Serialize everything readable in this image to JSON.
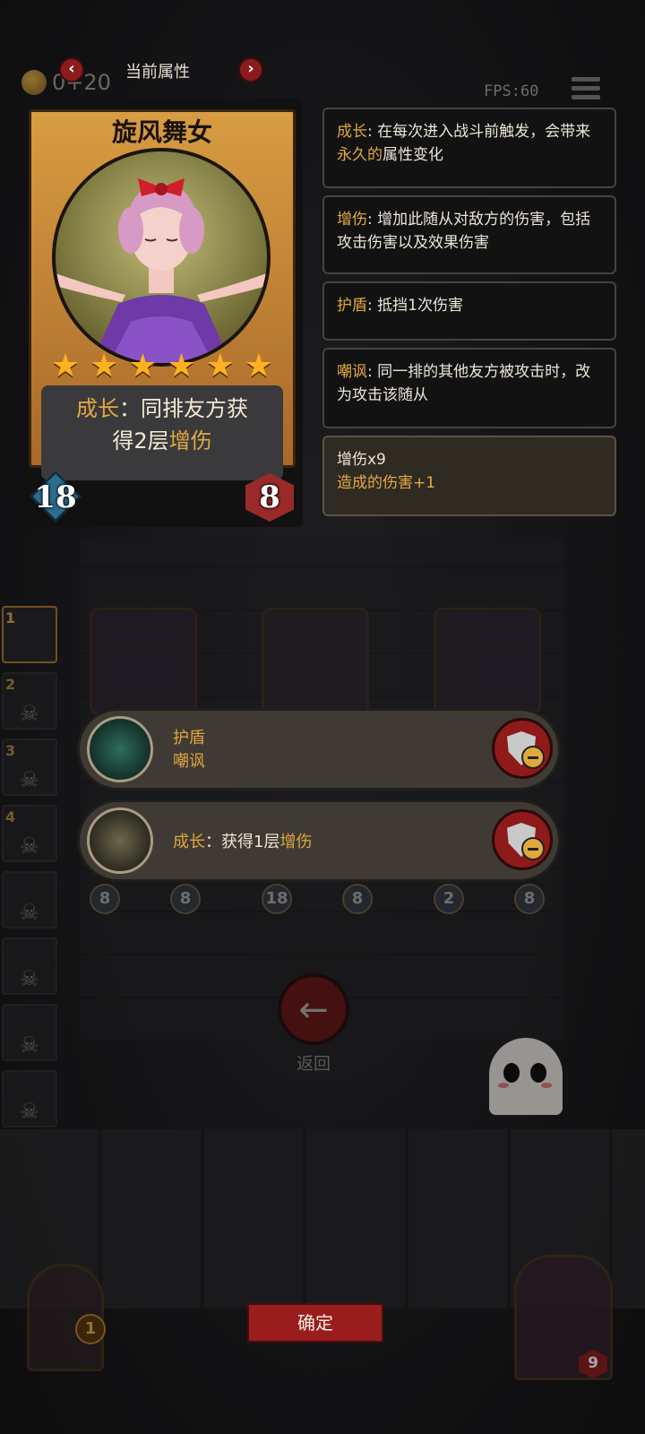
{
  "top_bar": {
    "gold_text": "0+20",
    "fps": "FPS:60",
    "title": "当前属性",
    "prev_arrow": "‹",
    "next_arrow": "›"
  },
  "hero_card": {
    "name": "旋风舞女",
    "stars": 6,
    "ability_keyword": "成长",
    "ability_text_1": "：同排友方获",
    "ability_text_2a": "得2层",
    "ability_text_2b": "增伤",
    "attack": "18",
    "health": "8"
  },
  "tooltips": [
    {
      "keyword": "成长",
      "text": ": 在每次进入战斗前触发，会带来",
      "highlight": "永久的",
      "tail": "属性变化"
    },
    {
      "keyword": "增伤",
      "text": ": 增加此随从对敌方的伤害，包括攻击伤害以及效果伤害"
    },
    {
      "keyword": "护盾",
      "text": ": 抵挡1次伤害"
    },
    {
      "keyword": "嘲讽",
      "text": ": 同一排的其他友方被攻击时，改为攻击该随从"
    }
  ],
  "buff_info": {
    "line1": "增伤x9",
    "line2": "造成的伤害+1"
  },
  "buff_rows": [
    {
      "line1": "护盾",
      "line2": "嘲讽",
      "icon": "shield-crystal-icon"
    },
    {
      "keyword": "成长",
      "text": "：获得1层",
      "highlight": "增伤",
      "icon": "green-crystal-icon"
    }
  ],
  "queue_numbers": [
    "1",
    "2",
    "3",
    "4"
  ],
  "board_stats": [
    "8",
    "8",
    "18",
    "8",
    "2",
    "8"
  ],
  "return_label": "返回",
  "confirm_label": "确定",
  "deck_left_count": "1",
  "deck_right_count": "9",
  "colors": {
    "keyword": "#e4a941",
    "button_red": "#9a1d1d",
    "card_wood": "#d89c42"
  }
}
